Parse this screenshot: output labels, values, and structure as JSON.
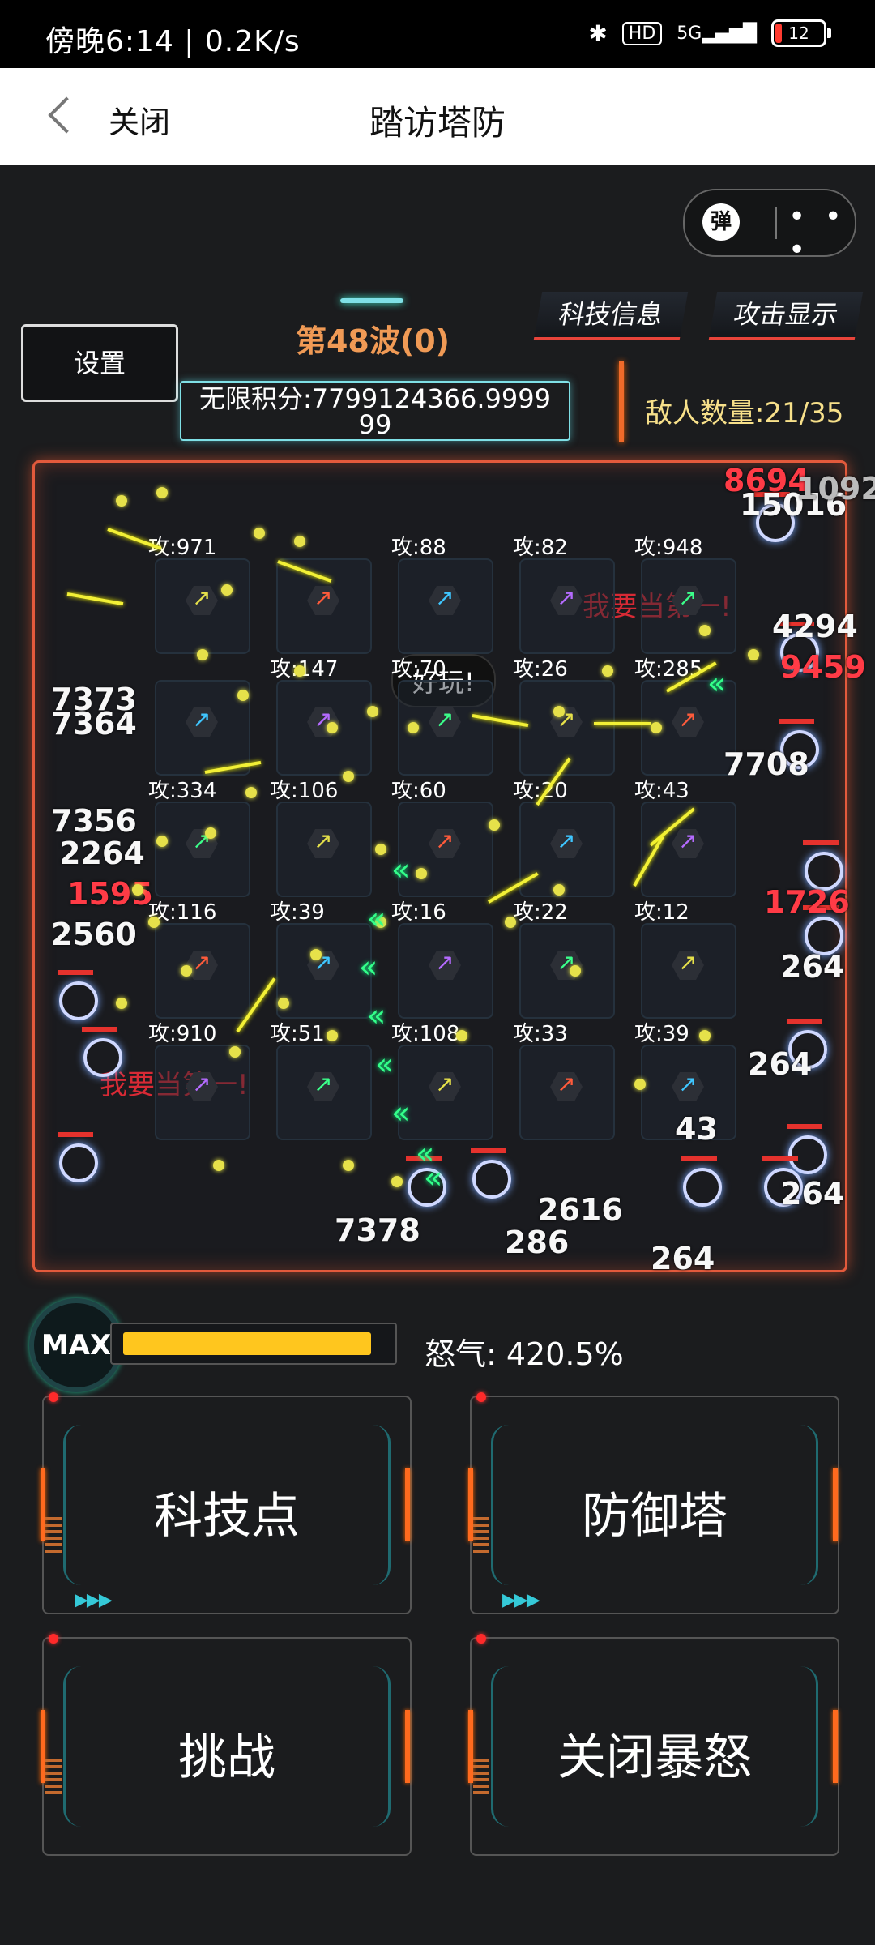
{
  "status_bar": {
    "time_text": "傍晚6:14 | 0.2K/s",
    "hd_badge": "HD",
    "network": "5G",
    "battery": "12"
  },
  "title_bar": {
    "close_label": "关闭",
    "title": "踏访塔防"
  },
  "capsule": {
    "danmu_label": "弹",
    "more_dots": "• • •"
  },
  "hud": {
    "settings": "设置",
    "wave": "第48波(0)",
    "score": "无限积分:7799124366.9999 99",
    "tech_info": "科技信息",
    "attack_display": "攻击显示",
    "enemy_count": "敌人数量:21/35"
  },
  "towers": [
    [
      "攻:971",
      "",
      "攻:88",
      "攻:82",
      "攻:948"
    ],
    [
      "",
      "攻:147",
      "攻:70",
      "攻:26",
      "攻:285"
    ],
    [
      "攻:334",
      "攻:106",
      "攻:60",
      "攻:20",
      "攻:43"
    ],
    [
      "攻:116",
      "攻:39",
      "攻:16",
      "攻:22",
      "攻:12"
    ],
    [
      "攻:910",
      "攻:51",
      "攻:108",
      "攻:33",
      "攻:39"
    ]
  ],
  "bubble": "好玩!",
  "danmu": [
    "我要当第一!",
    "我要当第一!"
  ],
  "damage_numbers": [
    "8694",
    "15016",
    "4294",
    "9459",
    "7708",
    "7364",
    "7373",
    "7356",
    "2264",
    "1595",
    "2560",
    "264",
    "264",
    "264",
    "264",
    "2616",
    "286",
    "43",
    "7378",
    "1092",
    "1726"
  ],
  "rage": {
    "max_label": "MAX",
    "label": "怒气: 420.5%",
    "fill_fraction": 0.95
  },
  "actions": {
    "tech_points": "科技点",
    "defense_tower": "防御塔",
    "challenge": "挑战",
    "close_rage": "关闭暴怒"
  },
  "colors": {
    "accent_orange": "#f09a55",
    "rage_yellow": "#ffc61e",
    "frame_red": "#e35a3c",
    "cyan": "#7fe0e6"
  }
}
